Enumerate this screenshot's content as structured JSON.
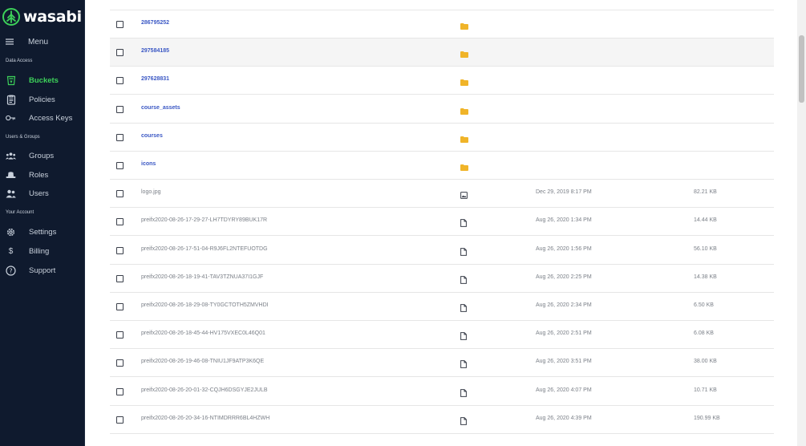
{
  "brand": {
    "name": "wasabi",
    "color": "#3dd15a"
  },
  "sidebar": {
    "menu_label": "Menu",
    "sections": [
      {
        "label": "Data Access"
      },
      {
        "label": "Users & Groups"
      },
      {
        "label": "Your Account"
      }
    ],
    "items": [
      {
        "label": "Buckets",
        "icon": "bucket-icon",
        "active": true
      },
      {
        "label": "Policies",
        "icon": "clipboard-icon"
      },
      {
        "label": "Access Keys",
        "icon": "key-icon"
      },
      {
        "label": "Groups",
        "icon": "group-icon"
      },
      {
        "label": "Roles",
        "icon": "hat-icon"
      },
      {
        "label": "Users",
        "icon": "users-icon"
      },
      {
        "label": "Settings",
        "icon": "gear-icon"
      },
      {
        "label": "Billing",
        "icon": "dollar-icon"
      },
      {
        "label": "Support",
        "icon": "help-icon"
      }
    ]
  },
  "files": [
    {
      "name": "286795252",
      "type": "folder",
      "date": "",
      "size": ""
    },
    {
      "name": "297584185",
      "type": "folder",
      "date": "",
      "size": "",
      "hover": true
    },
    {
      "name": "297628831",
      "type": "folder",
      "date": "",
      "size": ""
    },
    {
      "name": "course_assets",
      "type": "folder",
      "date": "",
      "size": ""
    },
    {
      "name": "courses",
      "type": "folder",
      "date": "",
      "size": ""
    },
    {
      "name": "icons",
      "type": "folder",
      "date": "",
      "size": ""
    },
    {
      "name": "logo.jpg",
      "type": "image",
      "date": "Dec 29, 2019 8:17 PM",
      "size": "82.21 KB"
    },
    {
      "name": "preifx2020-08-26-17-29-27-LH7TDYRY89BUK17R",
      "type": "file",
      "date": "Aug 26, 2020 1:34 PM",
      "size": "14.44 KB"
    },
    {
      "name": "preifx2020-08-26-17-51-04-R9J6FL2NTEFUOTDG",
      "type": "file",
      "date": "Aug 26, 2020 1:56 PM",
      "size": "56.10 KB"
    },
    {
      "name": "preifx2020-08-26-18-19-41-TAV3TZNUA37I1GJF",
      "type": "file",
      "date": "Aug 26, 2020 2:25 PM",
      "size": "14.38 KB"
    },
    {
      "name": "preifx2020-08-26-18-29-08-TY0GCTOTH5ZMVHDI",
      "type": "file",
      "date": "Aug 26, 2020 2:34 PM",
      "size": "6.50 KB"
    },
    {
      "name": "preifx2020-08-26-18-45-44-HV175VXEC0L46Q01",
      "type": "file",
      "date": "Aug 26, 2020 2:51 PM",
      "size": "6.08 KB"
    },
    {
      "name": "preifx2020-08-26-19-46-08-TNIU1JF9ATP3K6QE",
      "type": "file",
      "date": "Aug 26, 2020 3:51 PM",
      "size": "38.00 KB"
    },
    {
      "name": "preifx2020-08-26-20-01-32-CQJH6DSGYJE2JULB",
      "type": "file",
      "date": "Aug 26, 2020 4:07 PM",
      "size": "10.71 KB"
    },
    {
      "name": "preifx2020-08-26-20-34-16-NTIMDRRR6BL4HZWH",
      "type": "file",
      "date": "Aug 26, 2020 4:39 PM",
      "size": "190.99 KB"
    }
  ],
  "colors": {
    "folder": "#f0b429",
    "link": "#3a57c4",
    "sidebar_bg": "#0f1a2e"
  }
}
